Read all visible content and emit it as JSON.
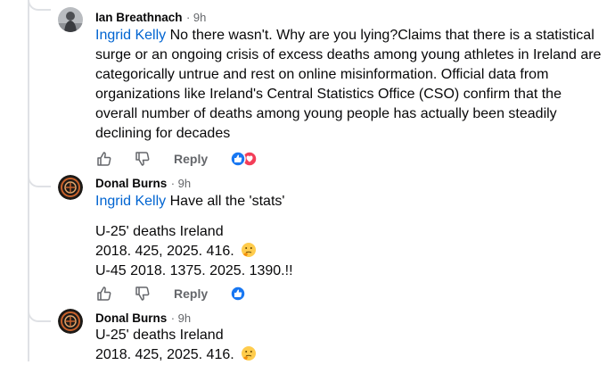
{
  "comments": [
    {
      "author": "Ian Breathnach",
      "time": "· 9h",
      "mention": "Ingrid Kelly",
      "text": "No there wasn't. Why are you lying?Claims that there is a statistical surge or an ongoing crisis of excess deaths among young athletes in Ireland are categorically untrue and rest on online misinformation. Official data from organizations like Ireland's Central Statistics Office (CSO) confirm that the overall number of deaths among young people has actually been steadily declining for decades",
      "reply_label": "Reply",
      "reactions": [
        "like",
        "love"
      ]
    },
    {
      "author": "Donal Burns",
      "time": "· 9h",
      "mention": "Ingrid Kelly",
      "first_line": "Have all the 'stats'",
      "lines": [
        "U-25' deaths Ireland",
        "2018. 425, 2025. 416.",
        "U-45 2018. 1375. 2025. 1390.!!"
      ],
      "reply_label": "Reply",
      "reactions": [
        "like"
      ]
    },
    {
      "author": "Donal Burns",
      "time": "· 9h",
      "lines": [
        "U-25' deaths Ireland",
        "2018. 425, 2025. 416."
      ]
    }
  ]
}
